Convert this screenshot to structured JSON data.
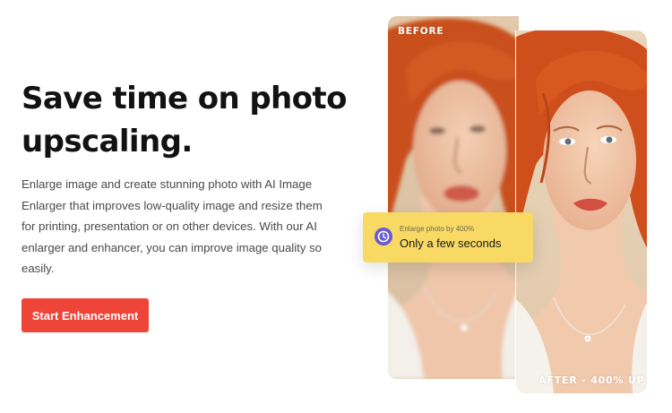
{
  "hero": {
    "headline_line1": "Save time on photo",
    "headline_line2": "upscaling.",
    "description_lines": [
      "Enlarge image and create stunning photo with AI Image",
      "Enlarger that improves low-quality image and resize them",
      "for printing, presentation or on other devices. With our AI",
      "enlarger and enhancer, you can improve image quality so",
      "easily."
    ],
    "cta_label": "Start Enhancement"
  },
  "comparison": {
    "before_label": "BEFORE",
    "after_label": "AFTER - 400% UP"
  },
  "badge": {
    "small_text": "Enlarge photo by 400%",
    "main_text": "Only a few seconds",
    "icon": "clock-icon"
  },
  "colors": {
    "headline": "#121212",
    "body_text": "#4a4a4a",
    "cta_background": "#ef4438",
    "badge_background": "#f7d964",
    "badge_icon": "#6b5bd2",
    "hair": "#d8521f",
    "skin": "#efc2a4",
    "background_photo": "#e8d4b8"
  }
}
